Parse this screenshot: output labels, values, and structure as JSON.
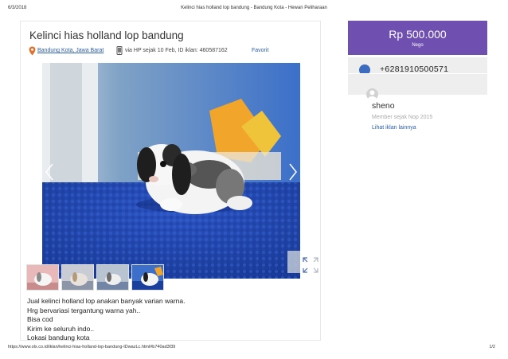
{
  "print_header": {
    "date": "6/3/2018",
    "title": "Kelinci hias holland lop bandung - Bandung Kota - Hewan Peliharaan"
  },
  "listing": {
    "title": "Kelinci hias holland lop bandung",
    "location": "Bandung Kota, Jawa Barat",
    "via": "via HP sejak 10 Feb, ID iklan: 460587162",
    "favorite_label": "Favorit",
    "description_lines": [
      "Jual kelinci holland lop anakan banyak varian warna.",
      "Hrg bervariasi tergantung warna yah..",
      "Bisa cod",
      "Kirim ke seluruh indo..",
      "Lokasi bandung kota"
    ]
  },
  "sidebar": {
    "price": "Rp 500.000",
    "nego": "Nego",
    "phone": "+6281910500571",
    "seller_name": "sheno",
    "member_since": "Member sejak Nop 2015",
    "more_ads": "Lihat iklan lainnya"
  },
  "print_footer": {
    "url": "https://www.olx.co.id/iklan/kelinci-hias-holland-lop-bandung-IDwazLc.html#b740ad3f39",
    "page": "1/2"
  },
  "colors": {
    "price_bg": "#6f4fb0",
    "link": "#2a5db0",
    "panel_bg": "#eeeeee"
  },
  "icons": {
    "location": "map-pin-icon",
    "phone": "mobile-phone-icon",
    "prev": "chevron-left-icon",
    "next": "chevron-right-icon",
    "expand": "expand-icon",
    "call": "phone-icon",
    "avatar": "user-avatar-icon"
  }
}
